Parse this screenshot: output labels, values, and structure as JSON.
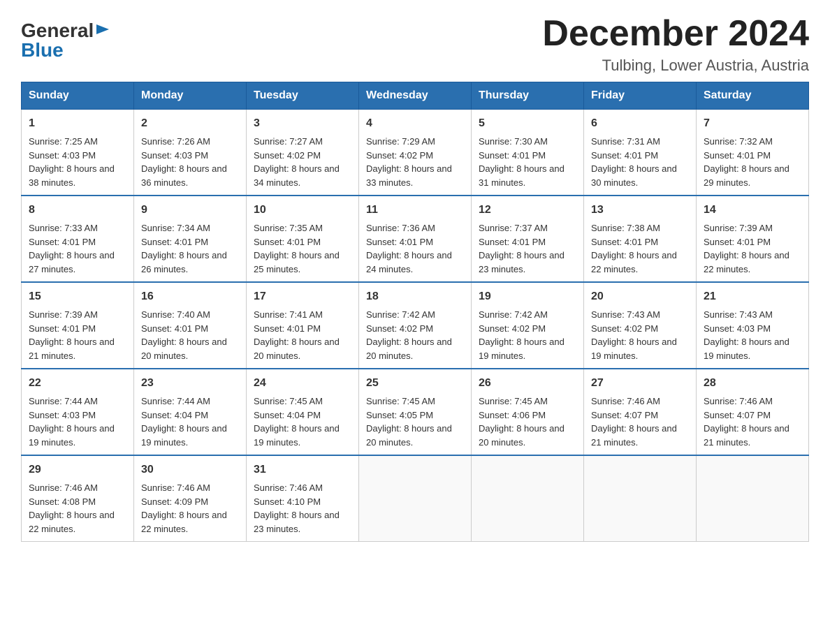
{
  "logo": {
    "general": "General",
    "triangle": "▶",
    "blue": "Blue"
  },
  "title": "December 2024",
  "location": "Tulbing, Lower Austria, Austria",
  "days_header": [
    "Sunday",
    "Monday",
    "Tuesday",
    "Wednesday",
    "Thursday",
    "Friday",
    "Saturday"
  ],
  "weeks": [
    [
      {
        "day": "1",
        "sunrise": "7:25 AM",
        "sunset": "4:03 PM",
        "daylight": "8 hours and 38 minutes."
      },
      {
        "day": "2",
        "sunrise": "7:26 AM",
        "sunset": "4:03 PM",
        "daylight": "8 hours and 36 minutes."
      },
      {
        "day": "3",
        "sunrise": "7:27 AM",
        "sunset": "4:02 PM",
        "daylight": "8 hours and 34 minutes."
      },
      {
        "day": "4",
        "sunrise": "7:29 AM",
        "sunset": "4:02 PM",
        "daylight": "8 hours and 33 minutes."
      },
      {
        "day": "5",
        "sunrise": "7:30 AM",
        "sunset": "4:01 PM",
        "daylight": "8 hours and 31 minutes."
      },
      {
        "day": "6",
        "sunrise": "7:31 AM",
        "sunset": "4:01 PM",
        "daylight": "8 hours and 30 minutes."
      },
      {
        "day": "7",
        "sunrise": "7:32 AM",
        "sunset": "4:01 PM",
        "daylight": "8 hours and 29 minutes."
      }
    ],
    [
      {
        "day": "8",
        "sunrise": "7:33 AM",
        "sunset": "4:01 PM",
        "daylight": "8 hours and 27 minutes."
      },
      {
        "day": "9",
        "sunrise": "7:34 AM",
        "sunset": "4:01 PM",
        "daylight": "8 hours and 26 minutes."
      },
      {
        "day": "10",
        "sunrise": "7:35 AM",
        "sunset": "4:01 PM",
        "daylight": "8 hours and 25 minutes."
      },
      {
        "day": "11",
        "sunrise": "7:36 AM",
        "sunset": "4:01 PM",
        "daylight": "8 hours and 24 minutes."
      },
      {
        "day": "12",
        "sunrise": "7:37 AM",
        "sunset": "4:01 PM",
        "daylight": "8 hours and 23 minutes."
      },
      {
        "day": "13",
        "sunrise": "7:38 AM",
        "sunset": "4:01 PM",
        "daylight": "8 hours and 22 minutes."
      },
      {
        "day": "14",
        "sunrise": "7:39 AM",
        "sunset": "4:01 PM",
        "daylight": "8 hours and 22 minutes."
      }
    ],
    [
      {
        "day": "15",
        "sunrise": "7:39 AM",
        "sunset": "4:01 PM",
        "daylight": "8 hours and 21 minutes."
      },
      {
        "day": "16",
        "sunrise": "7:40 AM",
        "sunset": "4:01 PM",
        "daylight": "8 hours and 20 minutes."
      },
      {
        "day": "17",
        "sunrise": "7:41 AM",
        "sunset": "4:01 PM",
        "daylight": "8 hours and 20 minutes."
      },
      {
        "day": "18",
        "sunrise": "7:42 AM",
        "sunset": "4:02 PM",
        "daylight": "8 hours and 20 minutes."
      },
      {
        "day": "19",
        "sunrise": "7:42 AM",
        "sunset": "4:02 PM",
        "daylight": "8 hours and 19 minutes."
      },
      {
        "day": "20",
        "sunrise": "7:43 AM",
        "sunset": "4:02 PM",
        "daylight": "8 hours and 19 minutes."
      },
      {
        "day": "21",
        "sunrise": "7:43 AM",
        "sunset": "4:03 PM",
        "daylight": "8 hours and 19 minutes."
      }
    ],
    [
      {
        "day": "22",
        "sunrise": "7:44 AM",
        "sunset": "4:03 PM",
        "daylight": "8 hours and 19 minutes."
      },
      {
        "day": "23",
        "sunrise": "7:44 AM",
        "sunset": "4:04 PM",
        "daylight": "8 hours and 19 minutes."
      },
      {
        "day": "24",
        "sunrise": "7:45 AM",
        "sunset": "4:04 PM",
        "daylight": "8 hours and 19 minutes."
      },
      {
        "day": "25",
        "sunrise": "7:45 AM",
        "sunset": "4:05 PM",
        "daylight": "8 hours and 20 minutes."
      },
      {
        "day": "26",
        "sunrise": "7:45 AM",
        "sunset": "4:06 PM",
        "daylight": "8 hours and 20 minutes."
      },
      {
        "day": "27",
        "sunrise": "7:46 AM",
        "sunset": "4:07 PM",
        "daylight": "8 hours and 21 minutes."
      },
      {
        "day": "28",
        "sunrise": "7:46 AM",
        "sunset": "4:07 PM",
        "daylight": "8 hours and 21 minutes."
      }
    ],
    [
      {
        "day": "29",
        "sunrise": "7:46 AM",
        "sunset": "4:08 PM",
        "daylight": "8 hours and 22 minutes."
      },
      {
        "day": "30",
        "sunrise": "7:46 AM",
        "sunset": "4:09 PM",
        "daylight": "8 hours and 22 minutes."
      },
      {
        "day": "31",
        "sunrise": "7:46 AM",
        "sunset": "4:10 PM",
        "daylight": "8 hours and 23 minutes."
      },
      null,
      null,
      null,
      null
    ]
  ]
}
